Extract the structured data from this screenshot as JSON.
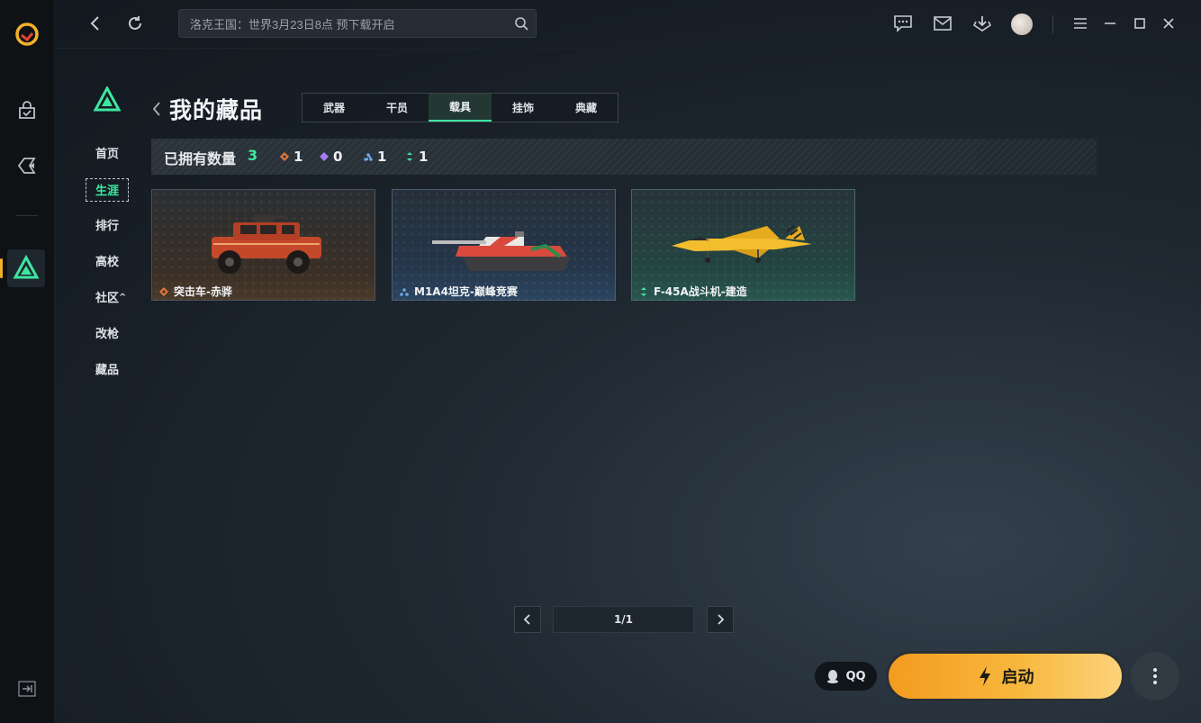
{
  "colors": {
    "accent": "#3ee6a0",
    "launch": "#f7b73c",
    "rare_orange": "#e0783a",
    "rare_purple": "#a77cf0",
    "rare_blue": "#6aa8ea",
    "rare_green": "#3ee6a0"
  },
  "topbar": {
    "search_placeholder": "洛克王国：世界3月23日8点 预下载开启",
    "icons": [
      "back-icon",
      "refresh-icon",
      "search-icon",
      "chat-icon",
      "mail-icon",
      "download-icon",
      "menu-icon",
      "minimize-icon",
      "maximize-icon",
      "close-icon"
    ]
  },
  "nav": {
    "items": [
      "首页",
      "生涯",
      "排行",
      "高校",
      "社区",
      "改枪",
      "藏品"
    ],
    "community_suffix": "^"
  },
  "page": {
    "title": "我的藏品",
    "tabs": [
      "武器",
      "干员",
      "载具",
      "挂饰",
      "典藏"
    ],
    "active_tab": "载具"
  },
  "owned": {
    "label": "已拥有数量",
    "total": "3",
    "rarities": [
      {
        "icon": "diamond-orange-icon",
        "count": "1"
      },
      {
        "icon": "diamond-purple-icon",
        "count": "0"
      },
      {
        "icon": "diamond-blue-icon",
        "count": "1"
      },
      {
        "icon": "diamond-green-icon",
        "count": "1"
      }
    ]
  },
  "cards": [
    {
      "name": "突击车-赤骅",
      "rarity": "orange"
    },
    {
      "name": "M1A4坦克-巅峰竞赛",
      "rarity": "blue"
    },
    {
      "name": "F-45A战斗机-建造",
      "rarity": "green"
    }
  ],
  "pager": {
    "page": "1/1"
  },
  "footer": {
    "qq_label": "QQ",
    "launch_label": "启动"
  }
}
